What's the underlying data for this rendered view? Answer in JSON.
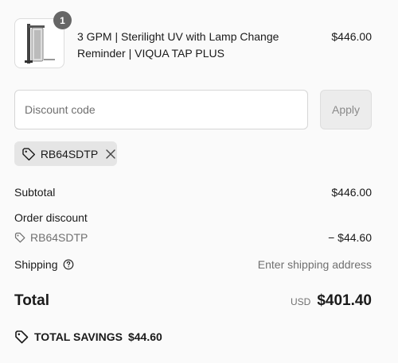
{
  "product": {
    "quantity": "1",
    "title": "3 GPM | Sterilight UV with Lamp Change Reminder | VIQUA TAP PLUS",
    "price": "$446.00",
    "image_icon": "uv-sterilizer-product-image"
  },
  "discount": {
    "placeholder": "Discount code",
    "apply_label": "Apply",
    "applied_code": "RB64SDTP"
  },
  "summary": {
    "subtotal_label": "Subtotal",
    "subtotal_value": "$446.00",
    "order_discount_label": "Order discount",
    "discount_code": "RB64SDTP",
    "discount_value": "− $44.60",
    "shipping_label": "Shipping",
    "shipping_value": "Enter shipping address",
    "total_label": "Total",
    "currency": "USD",
    "total_value": "$401.40",
    "savings_label": "TOTAL SAVINGS",
    "savings_value": "$44.60"
  },
  "colors": {
    "text": "#1a1a1a",
    "muted": "#707070",
    "badge": "#666666",
    "chip": "#e5e5e5"
  }
}
